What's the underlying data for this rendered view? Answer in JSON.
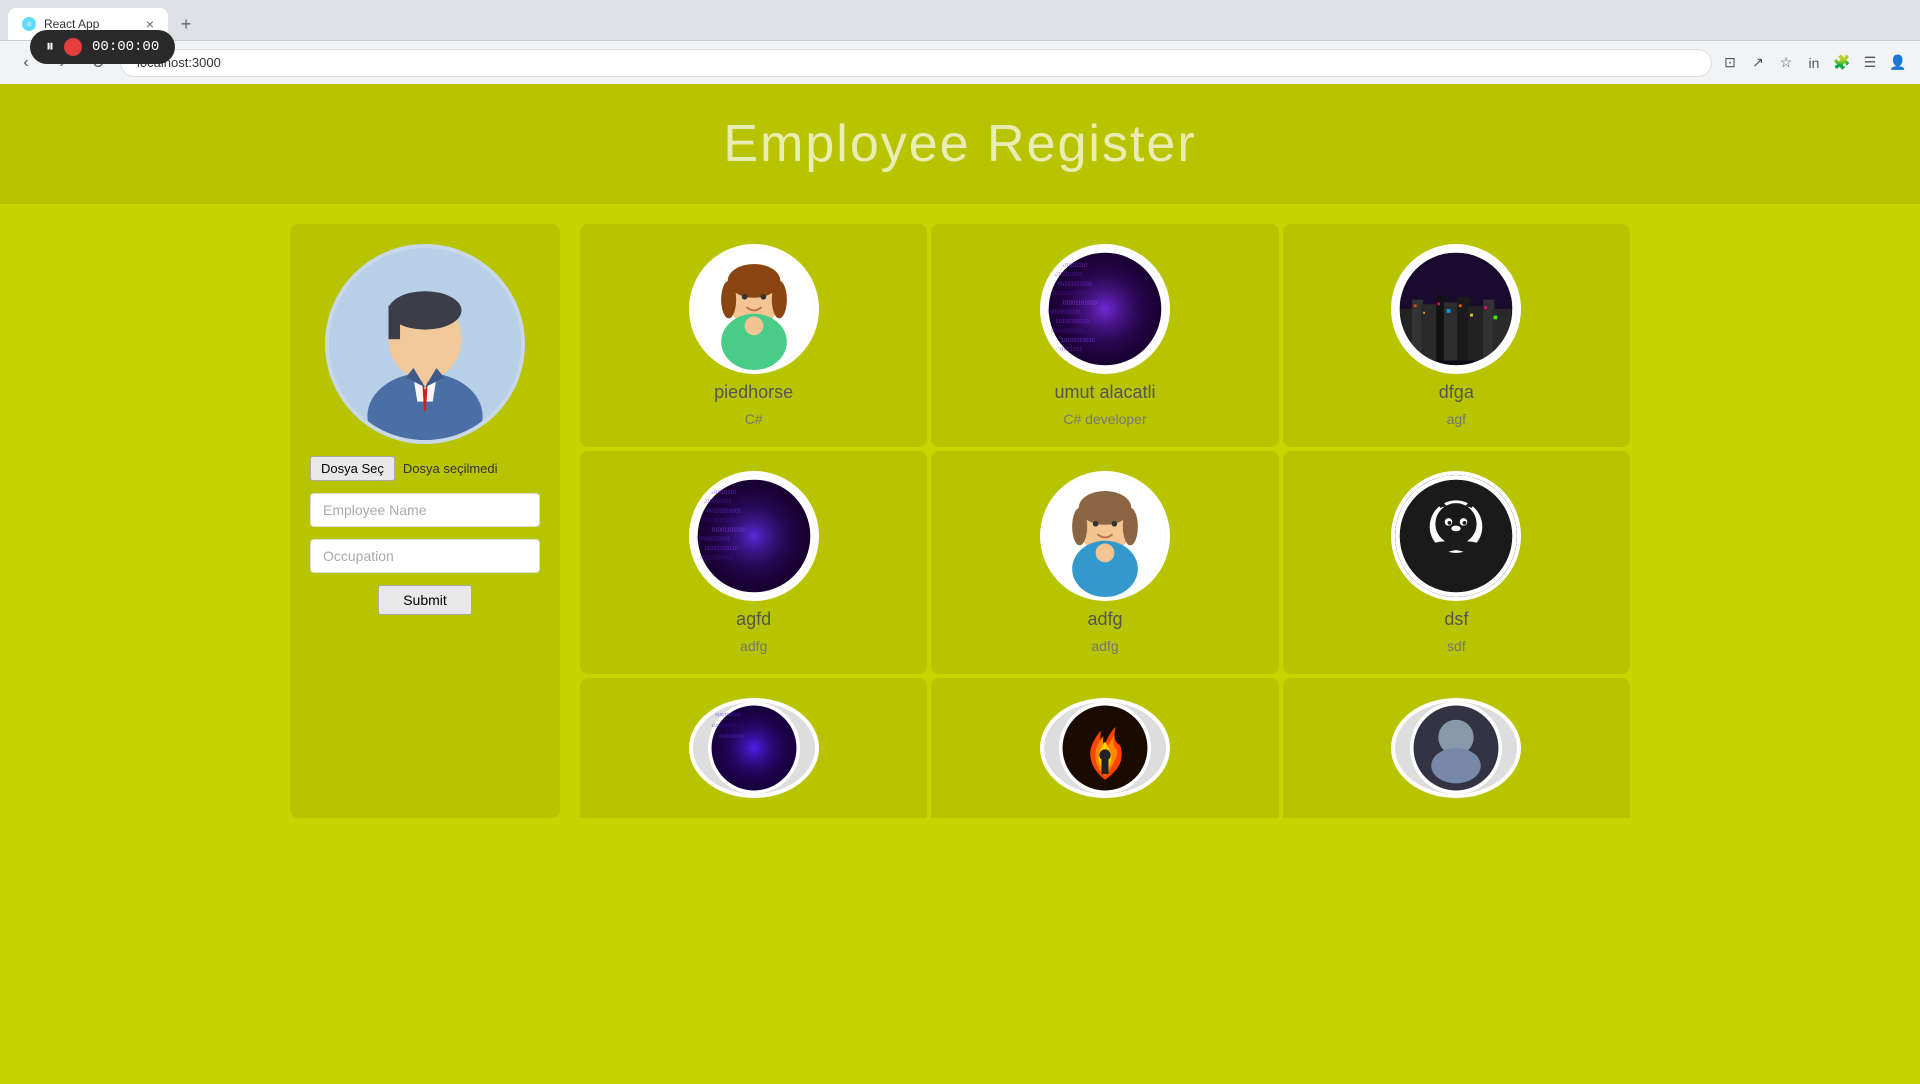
{
  "browser": {
    "tab_title": "React App",
    "url": "localhost:3000",
    "new_tab_label": "+",
    "close_label": "×"
  },
  "recording": {
    "time": "00:00:00"
  },
  "page": {
    "title": "Employee Register"
  },
  "form": {
    "file_button_label": "Dosya Seç",
    "file_status": "Dosya seçilmedi",
    "name_placeholder": "Employee Name",
    "occupation_placeholder": "Occupation",
    "submit_label": "Submit"
  },
  "employees": [
    {
      "name": "piedhorse",
      "occupation": "C#",
      "avatar_type": "girl1"
    },
    {
      "name": "umut alacatli",
      "occupation": "C# developer",
      "avatar_type": "code_purple"
    },
    {
      "name": "dfga",
      "occupation": "agf",
      "avatar_type": "city"
    },
    {
      "name": "agfd",
      "occupation": "adfg",
      "avatar_type": "code_purple"
    },
    {
      "name": "adfg",
      "occupation": "adfg",
      "avatar_type": "girl2"
    },
    {
      "name": "dsf",
      "occupation": "sdf",
      "avatar_type": "github"
    }
  ]
}
